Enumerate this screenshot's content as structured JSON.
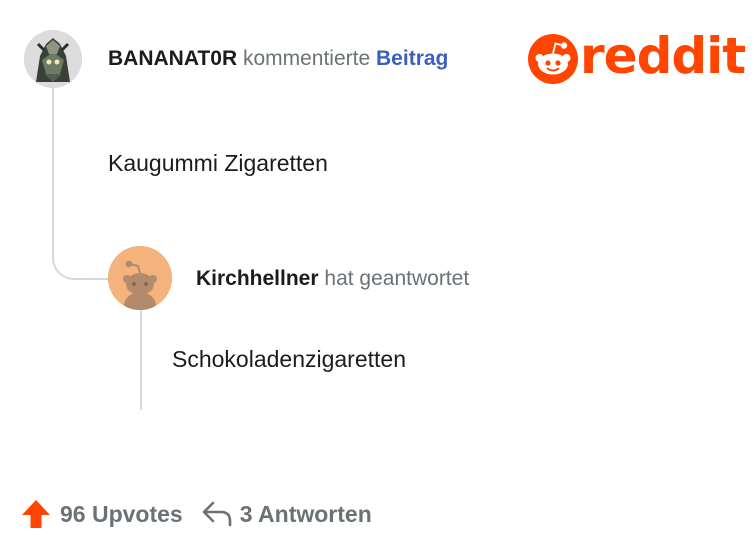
{
  "brand": {
    "logo_text": "reddit",
    "accent_color": "#ff4500",
    "logo_icon": "reddit-snoo-icon"
  },
  "comment": {
    "author": "BANANAT0R",
    "action": "kommentierte",
    "target": "Beitrag",
    "avatar_icon": "robot-avatar",
    "body": "Kaugummi Zigaretten"
  },
  "reply": {
    "author": "Kirchhellner",
    "action": "hat geantwortet",
    "avatar_icon": "snoo-default-avatar",
    "body": "Schokoladenzigaretten"
  },
  "footer": {
    "upvote_icon": "upvote-arrow-icon",
    "upvotes_label": "96 Upvotes",
    "reply_icon": "reply-arrow-icon",
    "replies_label": "3 Antworten"
  }
}
